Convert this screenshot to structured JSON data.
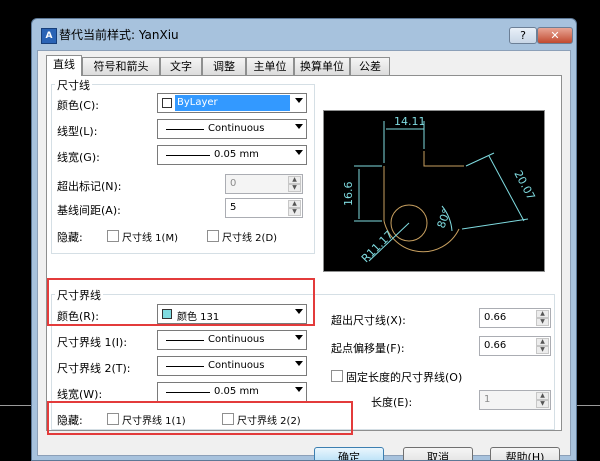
{
  "window": {
    "title": "替代当前样式: YanXiu",
    "help_label": "?",
    "close_label": "✕"
  },
  "tabs": [
    {
      "label": "直线",
      "active": true
    },
    {
      "label": "符号和箭头"
    },
    {
      "label": "文字"
    },
    {
      "label": "调整"
    },
    {
      "label": "主单位"
    },
    {
      "label": "换算单位"
    },
    {
      "label": "公差"
    }
  ],
  "dim_line": {
    "legend": "尺寸线",
    "color_label": "颜色(C):",
    "color_value": "ByLayer",
    "linetype_label": "线型(L):",
    "linetype_value": "Continuous",
    "lineweight_label": "线宽(G):",
    "lineweight_value": "0.05 mm",
    "extend_ticks_label": "超出标记(N):",
    "extend_ticks_value": "0",
    "baseline_label": "基线间距(A):",
    "baseline_value": "5",
    "suppress_label": "隐藏:",
    "suppress_1": "尺寸线 1(M)",
    "suppress_2": "尺寸线 2(D)"
  },
  "ext_line": {
    "legend": "尺寸界线",
    "color_label": "颜色(R):",
    "color_value": "颜色 131",
    "color_hex": "#7fdbe0",
    "linetype1_label": "尺寸界线 1(I):",
    "linetype1_value": "Continuous",
    "linetype2_label": "尺寸界线 2(T):",
    "linetype2_value": "Continuous",
    "lineweight_label": "线宽(W):",
    "lineweight_value": "0.05 mm",
    "suppress_label": "隐藏:",
    "suppress_1": "尺寸界线 1(1)",
    "suppress_2": "尺寸界线 2(2)",
    "extend_beyond_label": "超出尺寸线(X):",
    "extend_beyond_value": "0.66",
    "offset_label": "起点偏移量(F):",
    "offset_value": "0.66",
    "fixed_length_label": "固定长度的尺寸界线(O)",
    "length_label": "长度(E):",
    "length_value": "1"
  },
  "preview": {
    "dim_top": "14.11",
    "dim_left": "16.6",
    "dim_right": "20.07",
    "dim_angle": "80°",
    "dim_radius": "R11.17",
    "dim_color": "#7fdbe0",
    "geom_color": "#c8a060"
  },
  "buttons": {
    "ok": "确定",
    "cancel": "取消",
    "help": "帮助(H)"
  },
  "colors": {
    "highlight": "#e33b3b",
    "title_bar": "#a7c2dd"
  }
}
